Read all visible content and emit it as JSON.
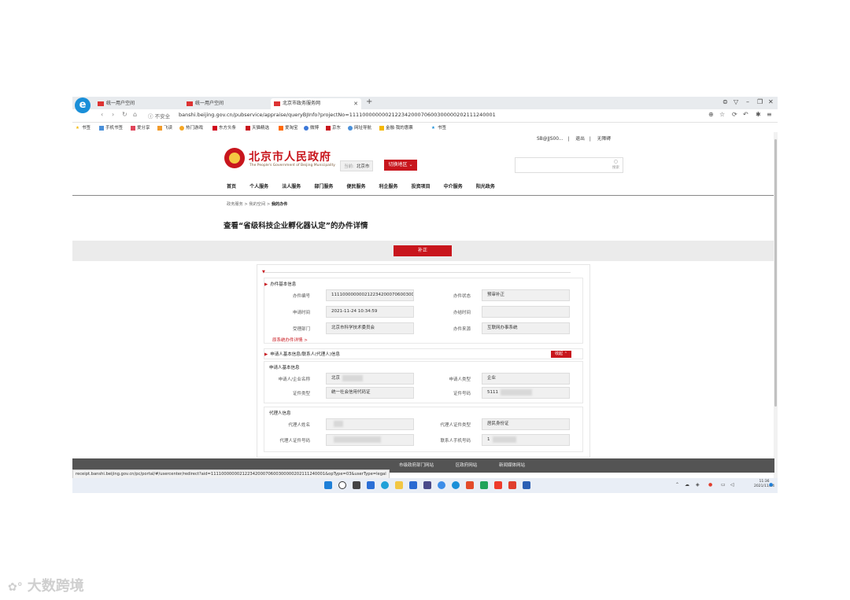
{
  "browser": {
    "tabs": [
      {
        "label": "统一用户空间",
        "active": false
      },
      {
        "label": "统一用户空间",
        "active": false
      },
      {
        "label": "北京市政务服务网",
        "active": true
      }
    ],
    "not_safe": "不安全",
    "url": "banshi.beijing.gov.cn/pubservice/appraise/queryBJInfo?projectNo=11110000000021223420007060030000020211124​0001",
    "bookmarks": [
      "书签",
      "手机书签",
      "爱分享",
      "飞读",
      "热门游戏",
      "东方头条",
      "天猫精选",
      "爱淘宝",
      "微博",
      "京东",
      "网址导航",
      "金融·我的惠票",
      "书签"
    ]
  },
  "site": {
    "top_links": [
      "SB@JJS00...",
      "退出",
      "无障碍"
    ],
    "title": "北京市人民政府",
    "subtitle": "The People's Government of Beijing Municipality",
    "location_label": "当前:",
    "location_value": "北京市",
    "switch_label": "切换地区",
    "search_label": "搜索",
    "nav": [
      "首页",
      "个人服务",
      "法人服务",
      "部门服务",
      "便民服务",
      "利企服务",
      "投资项目",
      "中介服务",
      "阳光政务"
    ],
    "breadcrumb": [
      "政务服务",
      "我的空间",
      "我的办件"
    ],
    "page_title": "查看“省级科技企业孵化器认定”的办件详情",
    "action_button": "补正"
  },
  "detail": {
    "basic_title": "办件基本信息",
    "fields": [
      {
        "label": "办件编号",
        "value": "111100000000212234200070600300"
      },
      {
        "label": "办件状态",
        "value": "预审补正"
      },
      {
        "label": "申请时间",
        "value": "2021-11-24 10:34:59"
      },
      {
        "label": "办结时间",
        "value": ""
      },
      {
        "label": "受理部门",
        "value": "北京市科学技术委员会"
      },
      {
        "label": "办件来源",
        "value": "互联网办事系统"
      }
    ],
    "more_link": "原系统办件详情 >",
    "applicant_section": "申请人基本信息/联系人(代理人)信息",
    "collapse_label": "收起",
    "applicant_title": "申请人基本信息",
    "applicant_fields": [
      {
        "label": "申请人/企业名称",
        "value": "北京"
      },
      {
        "label": "申请人类型",
        "value": "企业"
      },
      {
        "label": "证件类型",
        "value": "统一社会信用代码证"
      },
      {
        "label": "证件号码",
        "value": "5111"
      }
    ],
    "agent_title": "代理人信息",
    "agent_fields": [
      {
        "label": "代理人姓名",
        "value": ""
      },
      {
        "label": "代理人证件类型",
        "value": "居民身份证"
      },
      {
        "label": "代理人证件号码",
        "value": ""
      },
      {
        "label": "联系人手机号码",
        "value": "1"
      }
    ]
  },
  "footer": {
    "links": [
      "市级政府部门网站",
      "区政府网站",
      "新闻媒体网站"
    ],
    "status_url": "receipt.banshi.beijing.gov.cn/pc/portal/#/usercenter/redirect?aid=11110000000212234200070600300000202111240001&opType=03&userType=legal"
  },
  "taskbar": {
    "time": "11:36",
    "date": "2021/11/24"
  },
  "watermark": "大数跨境"
}
